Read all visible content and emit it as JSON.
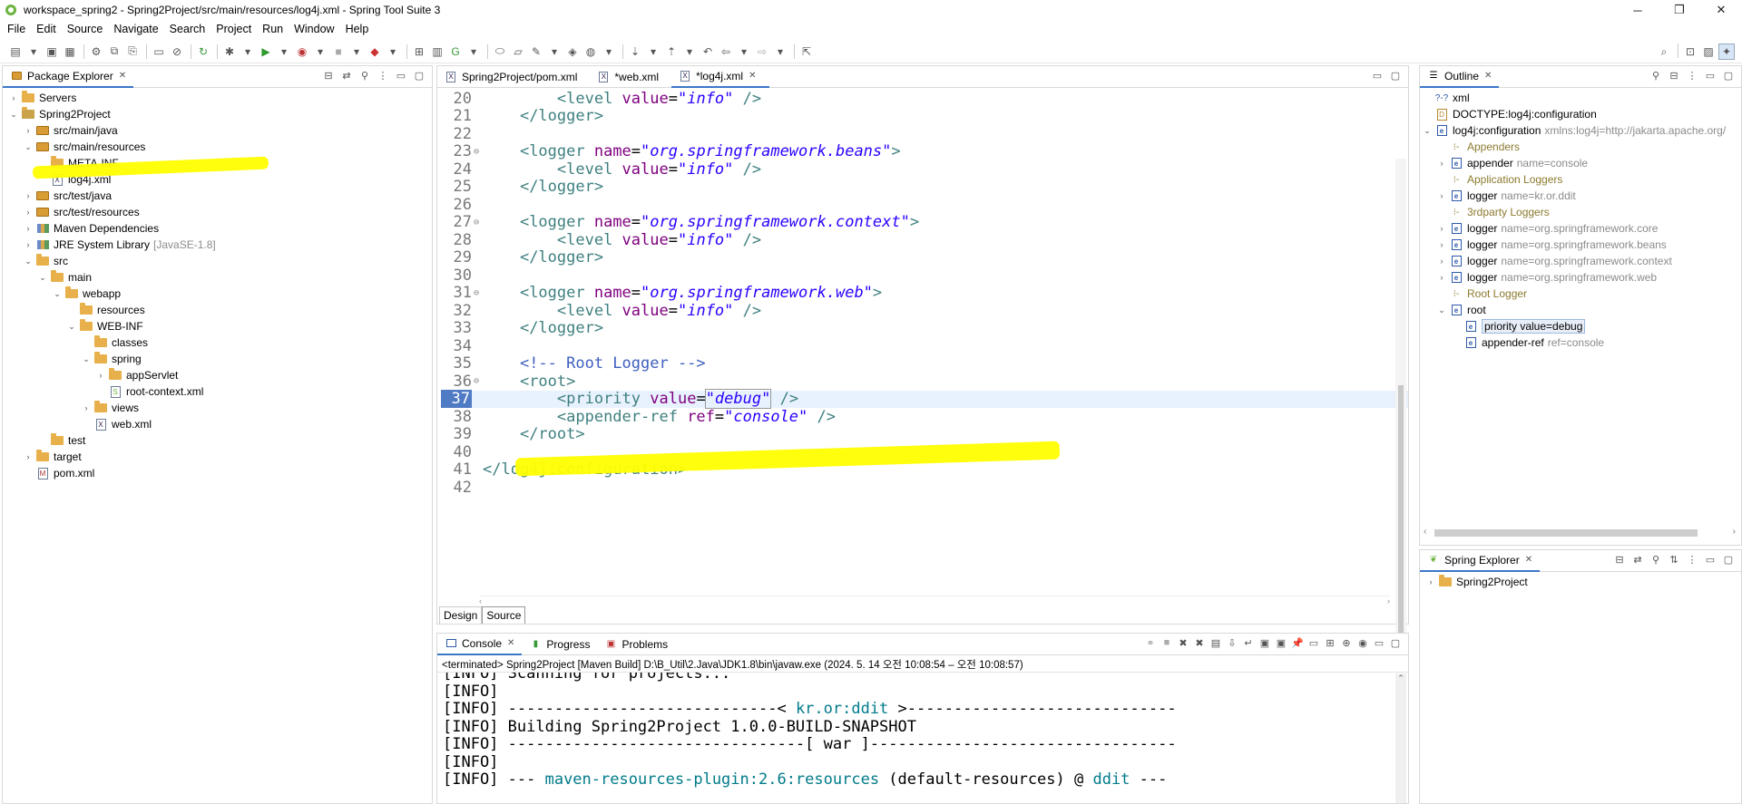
{
  "window": {
    "title": "workspace_spring2 - Spring2Project/src/main/resources/log4j.xml - Spring Tool Suite 3",
    "min": "─",
    "max": "❐",
    "close": "✕"
  },
  "menu": [
    "File",
    "Edit",
    "Source",
    "Navigate",
    "Search",
    "Project",
    "Run",
    "Window",
    "Help"
  ],
  "package_explorer": {
    "tab": "Package Explorer",
    "rows": [
      {
        "indent": 0,
        "twisty": "›",
        "icon": "folder",
        "label": "Servers",
        "decor": ""
      },
      {
        "indent": 0,
        "twisty": "⌄",
        "icon": "project",
        "label": "Spring2Project",
        "decor": ""
      },
      {
        "indent": 1,
        "twisty": "›",
        "icon": "pkg",
        "label": "src/main/java",
        "decor": ""
      },
      {
        "indent": 1,
        "twisty": "⌄",
        "icon": "pkg",
        "label": "src/main/resources",
        "decor": ""
      },
      {
        "indent": 2,
        "twisty": "",
        "icon": "folder",
        "label": "META-INF",
        "decor": ""
      },
      {
        "indent": 2,
        "twisty": "",
        "icon": "xml",
        "label": "log4j.xml",
        "decor": ""
      },
      {
        "indent": 1,
        "twisty": "›",
        "icon": "pkg",
        "label": "src/test/java",
        "decor": ""
      },
      {
        "indent": 1,
        "twisty": "›",
        "icon": "pkg",
        "label": "src/test/resources",
        "decor": ""
      },
      {
        "indent": 1,
        "twisty": "›",
        "icon": "lib",
        "label": "Maven Dependencies",
        "decor": ""
      },
      {
        "indent": 1,
        "twisty": "›",
        "icon": "lib",
        "label": "JRE System Library",
        "decor": "[JavaSE-1.8]"
      },
      {
        "indent": 1,
        "twisty": "⌄",
        "icon": "folder",
        "label": "src",
        "decor": ""
      },
      {
        "indent": 2,
        "twisty": "⌄",
        "icon": "folder",
        "label": "main",
        "decor": ""
      },
      {
        "indent": 3,
        "twisty": "⌄",
        "icon": "folder",
        "label": "webapp",
        "decor": ""
      },
      {
        "indent": 4,
        "twisty": "",
        "icon": "folder",
        "label": "resources",
        "decor": ""
      },
      {
        "indent": 4,
        "twisty": "⌄",
        "icon": "folder",
        "label": "WEB-INF",
        "decor": ""
      },
      {
        "indent": 5,
        "twisty": "",
        "icon": "folder",
        "label": "classes",
        "decor": ""
      },
      {
        "indent": 5,
        "twisty": "⌄",
        "icon": "folder",
        "label": "spring",
        "decor": ""
      },
      {
        "indent": 6,
        "twisty": "›",
        "icon": "folder",
        "label": "appServlet",
        "decor": ""
      },
      {
        "indent": 6,
        "twisty": "",
        "icon": "springxml",
        "label": "root-context.xml",
        "decor": ""
      },
      {
        "indent": 5,
        "twisty": "›",
        "icon": "folder",
        "label": "views",
        "decor": ""
      },
      {
        "indent": 5,
        "twisty": "",
        "icon": "xml",
        "label": "web.xml",
        "decor": ""
      },
      {
        "indent": 2,
        "twisty": "",
        "icon": "folder",
        "label": "test",
        "decor": ""
      },
      {
        "indent": 1,
        "twisty": "›",
        "icon": "folder",
        "label": "target",
        "decor": ""
      },
      {
        "indent": 1,
        "twisty": "",
        "icon": "pom",
        "label": "pom.xml",
        "decor": ""
      }
    ]
  },
  "editor": {
    "tabs": [
      {
        "label": "Spring2Project/pom.xml",
        "active": false
      },
      {
        "label": "*web.xml",
        "active": false
      },
      {
        "label": "*log4j.xml",
        "active": true
      }
    ],
    "lines": [
      {
        "n": "20",
        "fold": "",
        "segs": [
          [
            "p",
            "        "
          ],
          [
            "tag",
            "<level "
          ],
          [
            "attr",
            "value"
          ],
          [
            "p",
            "="
          ],
          [
            "val",
            "\"info\""
          ],
          [
            "tag",
            " />"
          ]
        ]
      },
      {
        "n": "21",
        "fold": "",
        "segs": [
          [
            "p",
            "    "
          ],
          [
            "tag",
            "</logger>"
          ]
        ]
      },
      {
        "n": "22",
        "fold": "",
        "segs": []
      },
      {
        "n": "23",
        "fold": "⊖",
        "segs": [
          [
            "p",
            "    "
          ],
          [
            "tag",
            "<logger "
          ],
          [
            "attr",
            "name"
          ],
          [
            "p",
            "="
          ],
          [
            "val",
            "\"org.springframework.beans\""
          ],
          [
            "tag",
            ">"
          ]
        ]
      },
      {
        "n": "24",
        "fold": "",
        "segs": [
          [
            "p",
            "        "
          ],
          [
            "tag",
            "<level "
          ],
          [
            "attr",
            "value"
          ],
          [
            "p",
            "="
          ],
          [
            "val",
            "\"info\""
          ],
          [
            "tag",
            " />"
          ]
        ]
      },
      {
        "n": "25",
        "fold": "",
        "segs": [
          [
            "p",
            "    "
          ],
          [
            "tag",
            "</logger>"
          ]
        ]
      },
      {
        "n": "26",
        "fold": "",
        "segs": []
      },
      {
        "n": "27",
        "fold": "⊖",
        "segs": [
          [
            "p",
            "    "
          ],
          [
            "tag",
            "<logger "
          ],
          [
            "attr",
            "name"
          ],
          [
            "p",
            "="
          ],
          [
            "val",
            "\"org.springframework.context\""
          ],
          [
            "tag",
            ">"
          ]
        ]
      },
      {
        "n": "28",
        "fold": "",
        "segs": [
          [
            "p",
            "        "
          ],
          [
            "tag",
            "<level "
          ],
          [
            "attr",
            "value"
          ],
          [
            "p",
            "="
          ],
          [
            "val",
            "\"info\""
          ],
          [
            "tag",
            " />"
          ]
        ]
      },
      {
        "n": "29",
        "fold": "",
        "segs": [
          [
            "p",
            "    "
          ],
          [
            "tag",
            "</logger>"
          ]
        ]
      },
      {
        "n": "30",
        "fold": "",
        "segs": []
      },
      {
        "n": "31",
        "fold": "⊖",
        "segs": [
          [
            "p",
            "    "
          ],
          [
            "tag",
            "<logger "
          ],
          [
            "attr",
            "name"
          ],
          [
            "p",
            "="
          ],
          [
            "val",
            "\"org.springframework.web\""
          ],
          [
            "tag",
            ">"
          ]
        ]
      },
      {
        "n": "32",
        "fold": "",
        "segs": [
          [
            "p",
            "        "
          ],
          [
            "tag",
            "<level "
          ],
          [
            "attr",
            "value"
          ],
          [
            "p",
            "="
          ],
          [
            "val",
            "\"info\""
          ],
          [
            "tag",
            " />"
          ]
        ]
      },
      {
        "n": "33",
        "fold": "",
        "segs": [
          [
            "p",
            "    "
          ],
          [
            "tag",
            "</logger>"
          ]
        ]
      },
      {
        "n": "34",
        "fold": "",
        "segs": []
      },
      {
        "n": "35",
        "fold": "",
        "segs": [
          [
            "p",
            "    "
          ],
          [
            "cmt",
            "<!-- Root Logger -->"
          ]
        ]
      },
      {
        "n": "36",
        "fold": "⊖",
        "segs": [
          [
            "p",
            "    "
          ],
          [
            "tag",
            "<root>"
          ]
        ]
      },
      {
        "n": "37",
        "fold": "",
        "segs": [
          [
            "p",
            "        "
          ],
          [
            "tag",
            "<priority "
          ],
          [
            "attr",
            "value"
          ],
          [
            "p",
            "="
          ],
          [
            "val",
            "\"debug\""
          ],
          [
            "tag",
            " />"
          ]
        ]
      },
      {
        "n": "38",
        "fold": "",
        "segs": [
          [
            "p",
            "        "
          ],
          [
            "tag",
            "<appender-ref "
          ],
          [
            "attr",
            "ref"
          ],
          [
            "p",
            "="
          ],
          [
            "val",
            "\"console\""
          ],
          [
            "tag",
            " />"
          ]
        ]
      },
      {
        "n": "39",
        "fold": "",
        "segs": [
          [
            "p",
            "    "
          ],
          [
            "tag",
            "</root>"
          ]
        ]
      },
      {
        "n": "40",
        "fold": "",
        "segs": []
      },
      {
        "n": "41",
        "fold": "",
        "segs": [
          [
            "tag",
            "</log4j:configuration>"
          ]
        ]
      },
      {
        "n": "42",
        "fold": "",
        "segs": []
      }
    ],
    "bottom_tabs": [
      "Design",
      "Source"
    ]
  },
  "outline": {
    "tab": "Outline",
    "rows": [
      {
        "indent": 0,
        "twisty": "",
        "icon": "pi",
        "label": "xml",
        "decor": "",
        "decor_color": ""
      },
      {
        "indent": 0,
        "twisty": "",
        "icon": "doctype",
        "label": "DOCTYPE:log4j:configuration",
        "decor": "",
        "decor_color": ""
      },
      {
        "indent": 0,
        "twisty": "⌄",
        "icon": "e",
        "label": "log4j:configuration",
        "decor": "xmlns:log4j=http://jakarta.apache.org/",
        "decor_color": "grey"
      },
      {
        "indent": 1,
        "twisty": "",
        "icon": "comment",
        "label": "Appenders",
        "decor": "",
        "decor_color": "olive"
      },
      {
        "indent": 1,
        "twisty": "›",
        "icon": "e",
        "label": "appender",
        "decor": "name=console",
        "decor_color": "grey"
      },
      {
        "indent": 1,
        "twisty": "",
        "icon": "comment",
        "label": "Application Loggers",
        "decor": "",
        "decor_color": "olive"
      },
      {
        "indent": 1,
        "twisty": "›",
        "icon": "e",
        "label": "logger",
        "decor": "name=kr.or.ddit",
        "decor_color": "grey"
      },
      {
        "indent": 1,
        "twisty": "",
        "icon": "comment",
        "label": "3rdparty Loggers",
        "decor": "",
        "decor_color": "olive"
      },
      {
        "indent": 1,
        "twisty": "›",
        "icon": "e",
        "label": "logger",
        "decor": "name=org.springframework.core",
        "decor_color": "grey"
      },
      {
        "indent": 1,
        "twisty": "›",
        "icon": "e",
        "label": "logger",
        "decor": "name=org.springframework.beans",
        "decor_color": "grey"
      },
      {
        "indent": 1,
        "twisty": "›",
        "icon": "e",
        "label": "logger",
        "decor": "name=org.springframework.context",
        "decor_color": "grey"
      },
      {
        "indent": 1,
        "twisty": "›",
        "icon": "e",
        "label": "logger",
        "decor": "name=org.springframework.web",
        "decor_color": "grey"
      },
      {
        "indent": 1,
        "twisty": "",
        "icon": "comment",
        "label": "Root Logger",
        "decor": "",
        "decor_color": "olive"
      },
      {
        "indent": 1,
        "twisty": "⌄",
        "icon": "e",
        "label": "root",
        "decor": "",
        "decor_color": ""
      },
      {
        "indent": 2,
        "twisty": "",
        "icon": "e",
        "label": "priority value=debug",
        "decor": "",
        "decor_color": ""
      },
      {
        "indent": 2,
        "twisty": "",
        "icon": "e",
        "label": "appender-ref",
        "decor": "ref=console",
        "decor_color": "grey"
      }
    ]
  },
  "spring_explorer": {
    "tab": "Spring Explorer",
    "rows": [
      {
        "label": "Spring2Project"
      }
    ]
  },
  "console": {
    "tabs": [
      "Console",
      "Progress",
      "Problems"
    ],
    "status": "<terminated> Spring2Project [Maven Build] D:\\B_Util\\2.Java\\JDK1.8\\bin\\javaw.exe  (2024. 5. 14 오전 10:08:54 – 오전 10:08:57)",
    "lines": [
      [
        [
          "p",
          "[INFO] Scanning for projects..."
        ]
      ],
      [
        [
          "p",
          "[INFO]"
        ]
      ],
      [
        [
          "p",
          "[INFO] -----------------------------< "
        ],
        [
          "b",
          "kr.or:ddit"
        ],
        [
          "p",
          " >-----------------------------"
        ]
      ],
      [
        [
          "p",
          "[INFO] Building Spring2Project 1.0.0-BUILD-SNAPSHOT"
        ]
      ],
      [
        [
          "p",
          "[INFO] --------------------------------[ war ]---------------------------------"
        ]
      ],
      [
        [
          "p",
          "[INFO]"
        ]
      ],
      [
        [
          "p",
          "[INFO] --- "
        ],
        [
          "b",
          "maven-resources-plugin:2.6:resources"
        ],
        [
          "p",
          " (default-resources) @ "
        ],
        [
          "b",
          "ddit"
        ],
        [
          "p",
          " ---"
        ]
      ]
    ]
  },
  "colors": {
    "highlight": "#ffff00",
    "tag": "#3f7f7f",
    "attr": "#7f007f",
    "value": "#2a00ff",
    "comment": "#3f5fbf"
  }
}
